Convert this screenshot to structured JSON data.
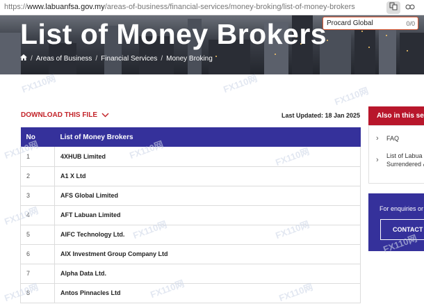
{
  "browser": {
    "url_prefix": "https://",
    "url_host": "www.labuanfsa.gov.my",
    "url_path": "/areas-of-business/financial-services/money-broking/list-of-money-brokers"
  },
  "find_bar": {
    "query": "Procard Global",
    "count": "0/0"
  },
  "banner": {
    "title": "List of Money Brokers",
    "breadcrumbs": [
      "Areas of Business",
      "Financial Services",
      "Money Broking"
    ]
  },
  "download": {
    "label": "DOWNLOAD THIS FILE"
  },
  "last_updated": "Last Updated: 18 Jan 2025",
  "table": {
    "headers": [
      "No",
      "List of Money Brokers"
    ],
    "rows": [
      [
        "1",
        "4XHUB Limited"
      ],
      [
        "2",
        "A1 X Ltd"
      ],
      [
        "3",
        "AFS Global Limited"
      ],
      [
        "4",
        "AFT Labuan Limited"
      ],
      [
        "5",
        "AIFC Technology Ltd."
      ],
      [
        "6",
        "AIX Investment Group Company Ltd"
      ],
      [
        "7",
        "Alpha Data Ltd."
      ],
      [
        "8",
        "Antos Pinnacles Ltd"
      ]
    ]
  },
  "sidebar": {
    "heading": "Also in this secti",
    "items": [
      {
        "line1": "FAQ",
        "line2": ""
      },
      {
        "line1": "List of Labua",
        "line2": "Surrendered &"
      }
    ],
    "contact": {
      "text": "For enquiries or",
      "button": "CONTACT U"
    }
  },
  "watermark": "FX110网",
  "colors": {
    "accent_red": "#c3242a",
    "table_header": "#35319b",
    "sidebar_red": "#b8162b"
  }
}
